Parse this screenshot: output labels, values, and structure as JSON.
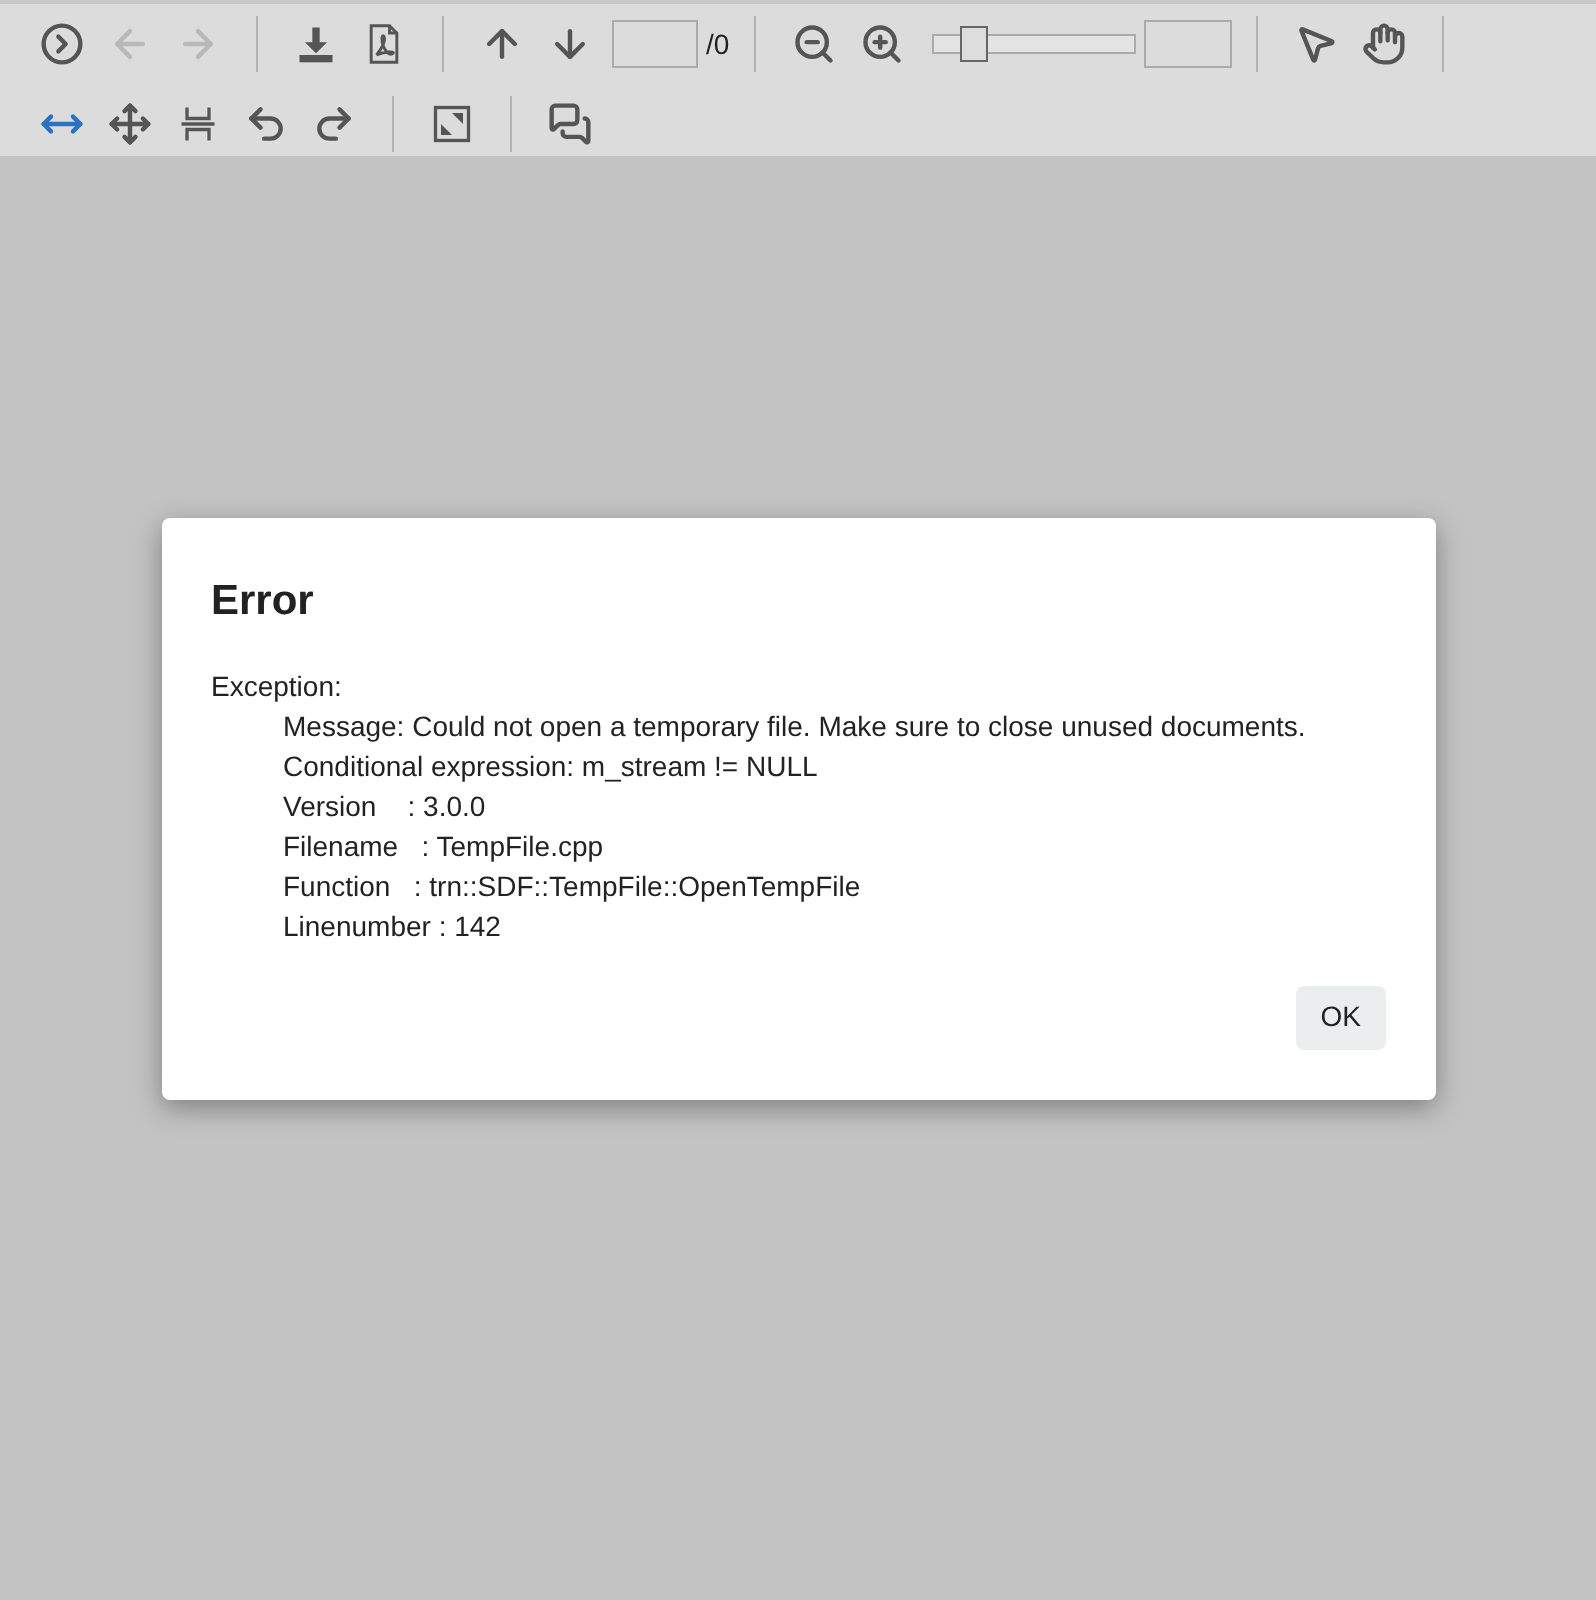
{
  "toolbar": {
    "row_1": [
      {
        "disabled": false
      },
      {
        "disabled": true
      },
      {
        "disabled": true
      },
      {
        "disabled": false
      },
      {
        "disabled": false
      },
      {
        "disabled": false
      },
      {
        "disabled": false
      },
      {
        "disabled": false
      },
      {
        "disabled": false
      },
      {
        "disabled": false
      },
      {
        "disabled": false
      }
    ],
    "page_total": "/0",
    "zoom_slider": {
      "level": 0.2
    },
    "row_2": [
      {
        "selected": true
      },
      {
        "selected": false
      },
      {
        "selected": false
      },
      {
        "selected": false
      },
      {
        "selected": false
      },
      {
        "selected": false
      },
      {
        "selected": false
      }
    ]
  },
  "dialog": {
    "title": "Error",
    "heading": "Exception:",
    "details": [
      "Message: Could not open a temporary file. Make sure to close unused documents.",
      "Conditional expression: m_stream != NULL",
      "Version    : 3.0.0",
      "Filename   : TempFile.cpp",
      "Function   : trn::SDF::TempFile::OpenTempFile",
      "Linenumber : 142"
    ],
    "button": "OK"
  }
}
